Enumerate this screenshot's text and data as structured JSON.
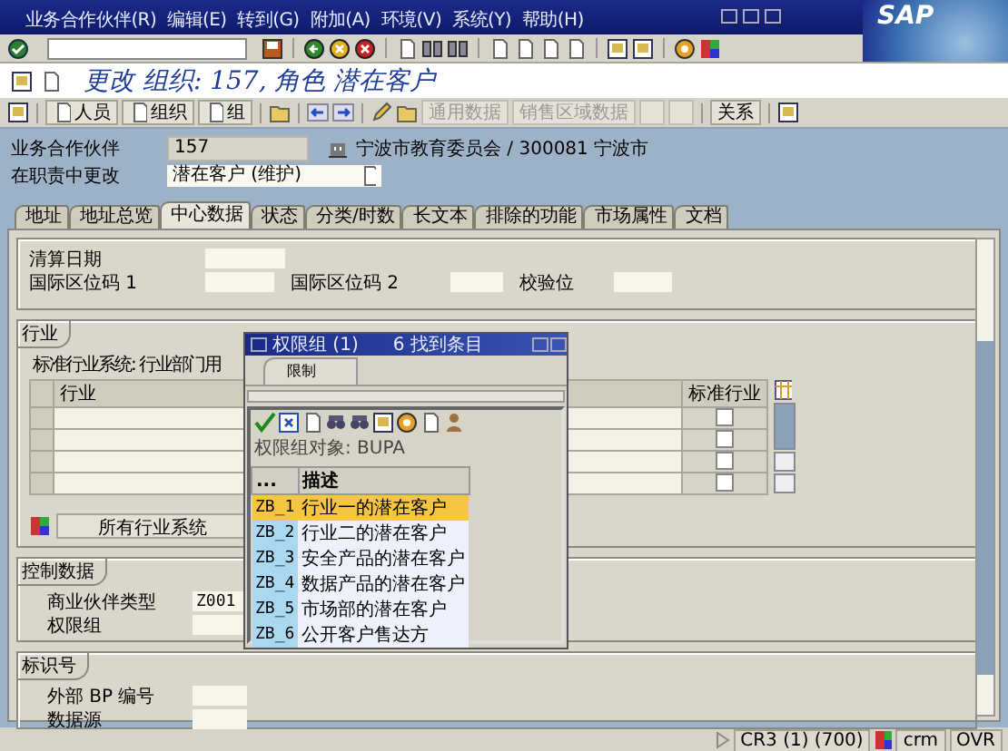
{
  "menu": [
    {
      "label": "业务合作伙伴(R)"
    },
    {
      "label": "编辑(E)"
    },
    {
      "label": "转到(G)"
    },
    {
      "label": "附加(A)"
    },
    {
      "label": "环境(V)"
    },
    {
      "label": "系统(Y)"
    },
    {
      "label": "帮助(H)"
    }
  ],
  "logo": "SAP",
  "title": "更改 组织: 157, 角色 潜在客户",
  "app_toolbar": [
    {
      "kind": "doc",
      "label": "人员",
      "disabled": false
    },
    {
      "kind": "doc",
      "label": "组织",
      "disabled": false
    },
    {
      "kind": "doc",
      "label": "组",
      "disabled": false
    },
    {
      "kind": "text",
      "label": "通用数据",
      "disabled": true
    },
    {
      "kind": "text",
      "label": "销售区域数据",
      "disabled": true
    },
    {
      "kind": "blank",
      "disabled": true
    },
    {
      "kind": "blank",
      "disabled": true
    },
    {
      "kind": "text",
      "label": "关系",
      "disabled": false
    }
  ],
  "header": {
    "partner_label": "业务合作伙伴",
    "partner": "157",
    "partner_desc": "宁波市教育委员会 / 300081 宁波市",
    "role_label": "在职责中更改",
    "role": "潜在客户 (维护)"
  },
  "tabs": [
    {
      "label": "地址",
      "selected": false
    },
    {
      "label": "地址总览",
      "selected": false
    },
    {
      "label": "中心数据",
      "selected": true
    },
    {
      "label": "状态",
      "selected": false
    },
    {
      "label": "分类/时数",
      "selected": false
    },
    {
      "label": "长文本",
      "selected": false
    },
    {
      "label": "排除的功能",
      "selected": false
    },
    {
      "label": "市场属性",
      "selected": false
    },
    {
      "label": "文档",
      "selected": false
    }
  ],
  "general": {
    "clearing_date_label": "清算日期",
    "loc1_label": "国际区位码 1",
    "loc2_label": "国际区位码 2",
    "check_digit_label": "校验位"
  },
  "industry": {
    "title": "行业",
    "system_label": "标准行业系统: 行业部门用",
    "columns": [
      "行业",
      "标准行业"
    ],
    "rows": [
      {
        "standard": false
      },
      {
        "standard": false
      },
      {
        "standard": false
      },
      {
        "standard": false
      }
    ],
    "button": "所有行业系统"
  },
  "control": {
    "title": "控制数据",
    "fields": [
      {
        "label": "商业伙伴类型",
        "value": "Z001"
      },
      {
        "label": "权限组"
      }
    ]
  },
  "ident": {
    "title": "标识号",
    "fields": [
      {
        "label": "外部 BP 编号"
      },
      {
        "label": "数据源"
      }
    ]
  },
  "popup": {
    "title": "权限组 (1)",
    "count": "6 找到条目",
    "tab": "限制",
    "object": "权限组对象: BUPA",
    "columns": [
      "...",
      "描述"
    ],
    "rows": [
      {
        "code": "ZB_1",
        "text": "行业一的潜在客户",
        "selected": true
      },
      {
        "code": "ZB_2",
        "text": "行业二的潜在客户",
        "selected": false
      },
      {
        "code": "ZB_3",
        "text": "安全产品的潜在客户",
        "selected": false
      },
      {
        "code": "ZB_4",
        "text": "数据产品的潜在客户",
        "selected": false
      },
      {
        "code": "ZB_5",
        "text": "市场部的潜在客户",
        "selected": false
      },
      {
        "code": "ZB_6",
        "text": "公开客户售达方",
        "selected": false
      }
    ]
  },
  "status": {
    "system": "CR3 (1) (700)",
    "server": "crm",
    "mode": "OVR"
  }
}
